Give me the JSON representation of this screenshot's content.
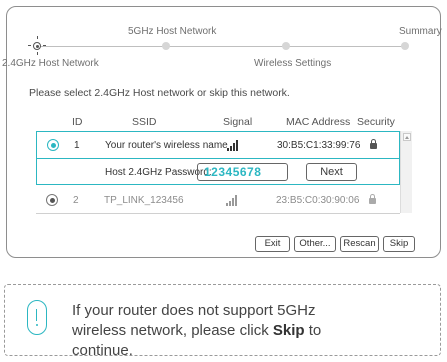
{
  "steps": {
    "step1": "2.4GHz Host Network",
    "step2": "5GHz Host Network",
    "step3": "Wireless Settings",
    "step4": "Summary"
  },
  "instruction": "Please select 2.4GHz Host network or skip this network.",
  "table": {
    "headers": {
      "id": "ID",
      "ssid": "SSID",
      "signal": "Signal",
      "mac": "MAC Address",
      "security": "Security"
    },
    "rows": [
      {
        "id": "1",
        "ssid": "Your router's wireless name",
        "signal_bars": 3,
        "mac": "30:B5:C1:33:99:76",
        "secured": true,
        "selected": true
      },
      {
        "id": "2",
        "ssid": "TP_LINK_123456",
        "signal_bars": 3,
        "mac": "23:B5:C0:30:90:06",
        "secured": true,
        "selected": false
      }
    ]
  },
  "password_row": {
    "label": "Host 2.4GHz Password:",
    "value": "12345678",
    "next_button": "Next"
  },
  "buttons": {
    "exit": "Exit",
    "other": "Other...",
    "rescan": "Rescan",
    "skip": "Skip"
  },
  "note": {
    "text_before": "If your router does not support 5GHz wireless network, please click ",
    "skip_word": "Skip",
    "text_after": " to continue."
  },
  "colors": {
    "accent": "#2cb7c2",
    "border": "#8e8e8e"
  },
  "icons": [
    "radio-selected-icon",
    "radio-unselected-icon",
    "signal-icon",
    "lock-icon",
    "scroll-up-arrow-icon",
    "info-icon"
  ]
}
